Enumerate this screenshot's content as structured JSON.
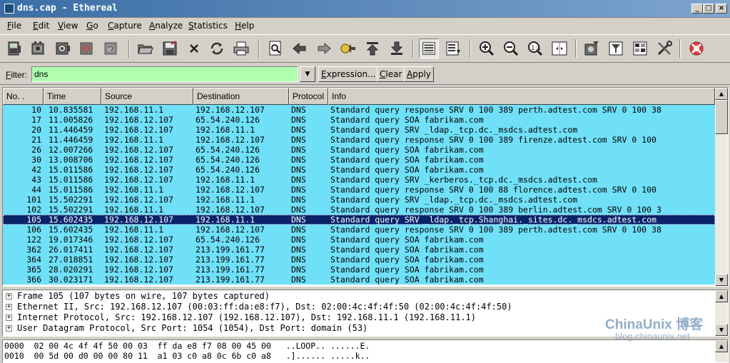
{
  "window": {
    "title": "dns.cap - Ethereal",
    "controls": {
      "minimize": "_",
      "maximize": "□",
      "close": "×"
    }
  },
  "menu": [
    {
      "label": "File",
      "key": "F",
      "rest": "ile"
    },
    {
      "label": "Edit",
      "key": "E",
      "rest": "dit"
    },
    {
      "label": "View",
      "key": "V",
      "rest": "iew"
    },
    {
      "label": "Go",
      "key": "G",
      "rest": "o"
    },
    {
      "label": "Capture",
      "key": "C",
      "rest": "apture"
    },
    {
      "label": "Analyze",
      "key": "A",
      "rest": "nalyze"
    },
    {
      "label": "Statistics",
      "key": "S",
      "rest": "tatistics"
    },
    {
      "label": "Help",
      "key": "H",
      "rest": "elp"
    }
  ],
  "toolbar": {
    "icons": [
      "interfaces-icon",
      "capture-options-icon",
      "start-capture-icon",
      "stop-capture-icon",
      "restart-capture-icon",
      "open-file-icon",
      "save-file-icon",
      "close-file-icon",
      "reload-icon",
      "print-icon",
      "find-packet-icon",
      "go-back-icon",
      "go-forward-icon",
      "go-to-packet-icon",
      "go-first-icon",
      "go-last-icon",
      "colorize-icon",
      "auto-scroll-icon",
      "zoom-in-icon",
      "zoom-out-icon",
      "zoom-normal-icon",
      "resize-columns-icon",
      "capture-filters-icon",
      "display-filters-icon",
      "coloring-rules-icon",
      "preferences-icon",
      "help-icon"
    ]
  },
  "filter": {
    "label": "Filter:",
    "value": "dns",
    "expression_label": "Expression...",
    "clear_label": "Clear",
    "apply_label": "Apply"
  },
  "packet_list": {
    "columns": [
      "No. .",
      "Time",
      "Source",
      "Destination",
      "Protocol",
      "Info"
    ],
    "row_color": "#70e0f8",
    "selected_color": "#0a246a",
    "selected_index": 11,
    "rows": [
      [
        "10",
        "10.835581",
        "192.168.11.1",
        "192.168.12.107",
        "DNS",
        "Standard query response SRV 0 100 389 perth.adtest.com SRV 0 100 38"
      ],
      [
        "17",
        "11.005826",
        "192.168.12.107",
        "65.54.240.126",
        "DNS",
        "Standard query SOA fabrikam.com"
      ],
      [
        "20",
        "11.446459",
        "192.168.12.107",
        "192.168.11.1",
        "DNS",
        "Standard query SRV _ldap._tcp.dc._msdcs.adtest.com"
      ],
      [
        "21",
        "11.446459",
        "192.168.11.1",
        "192.168.12.107",
        "DNS",
        "Standard query response SRV 0 100 389 firenze.adtest.com SRV 0 100"
      ],
      [
        "26",
        "12.007266",
        "192.168.12.107",
        "65.54.240.126",
        "DNS",
        "Standard query SOA fabrikam.com"
      ],
      [
        "30",
        "13.008706",
        "192.168.12.107",
        "65.54.240.126",
        "DNS",
        "Standard query SOA fabrikam.com"
      ],
      [
        "42",
        "15.011586",
        "192.168.12.107",
        "65.54.240.126",
        "DNS",
        "Standard query SOA fabrikam.com"
      ],
      [
        "43",
        "15.011586",
        "192.168.12.107",
        "192.168.11.1",
        "DNS",
        "Standard query SRV _kerberos._tcp.dc._msdcs.adtest.com"
      ],
      [
        "44",
        "15.011586",
        "192.168.11.1",
        "192.168.12.107",
        "DNS",
        "Standard query response SRV 0 100 88 florence.adtest.com SRV 0 100"
      ],
      [
        "101",
        "15.502291",
        "192.168.12.107",
        "192.168.11.1",
        "DNS",
        "Standard query SRV _ldap._tcp.dc._msdcs.adtest.com"
      ],
      [
        "102",
        "15.502291",
        "192.168.11.1",
        "192.168.12.107",
        "DNS",
        "Standard query response SRV 0 100 389 berlin.adtest.com SRV 0 100 3"
      ],
      [
        "105",
        "15.602435",
        "192.168.12.107",
        "192.168.11.1",
        "DNS",
        "Standard query SRV _ldap._tcp.Shanghai._sites.dc._msdcs.adtest.com"
      ],
      [
        "106",
        "15.602435",
        "192.168.11.1",
        "192.168.12.107",
        "DNS",
        "Standard query response SRV 0 100 389 perth.adtest.com SRV 0 100 38"
      ],
      [
        "122",
        "19.017346",
        "192.168.12.107",
        "65.54.240.126",
        "DNS",
        "Standard query SOA fabrikam.com"
      ],
      [
        "362",
        "26.017411",
        "192.168.12.107",
        "213.199.161.77",
        "DNS",
        "Standard query SOA fabrikam.com"
      ],
      [
        "364",
        "27.018851",
        "192.168.12.107",
        "213.199.161.77",
        "DNS",
        "Standard query SOA fabrikam.com"
      ],
      [
        "365",
        "28.020291",
        "192.168.12.107",
        "213.199.161.77",
        "DNS",
        "Standard query SOA fabrikam.com"
      ],
      [
        "366",
        "30.023171",
        "192.168.12.107",
        "213.199.161.77",
        "DNS",
        "Standard query SOA fabrikam.com"
      ]
    ]
  },
  "details": [
    {
      "expander": "+",
      "text": "Frame 105 (107 bytes on wire, 107 bytes captured)"
    },
    {
      "expander": "+",
      "text": "Ethernet II, Src: 192.168.12.107 (00:03:ff:da:e8:f7), Dst: 02:00:4c:4f:4f:50 (02:00:4c:4f:4f:50)"
    },
    {
      "expander": "+",
      "text": "Internet Protocol, Src: 192.168.12.107 (192.168.12.107), Dst: 192.168.11.1 (192.168.11.1)"
    },
    {
      "expander": "+",
      "text": "User Datagram Protocol, Src Port: 1054 (1054), Dst Port: domain (53)"
    }
  ],
  "hex": [
    {
      "offset": "0000",
      "bytes": "02 00 4c 4f 4f 50 00 03  ff da e8 f7 08 00 45 00",
      "ascii": "..LOOP.. ......E."
    },
    {
      "offset": "0010",
      "bytes": "00 5d 00 d0 00 00 80 11  a1 03 c0 a8 0c 6b c0 a8",
      "ascii": ".]...... .....k.."
    }
  ],
  "watermark": {
    "main": "ChinaUnix 博客",
    "sub": "blog.chinaunix.net"
  }
}
